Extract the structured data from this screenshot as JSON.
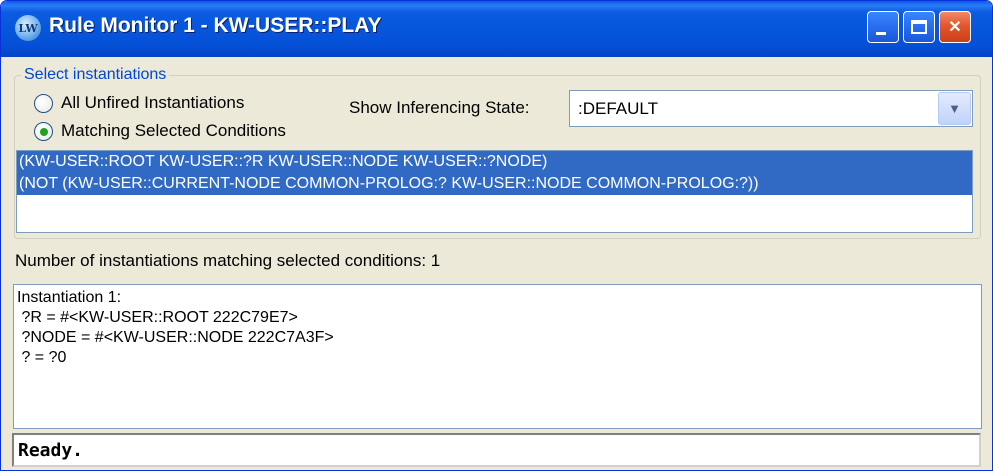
{
  "window": {
    "title": "Rule Monitor 1 - KW-USER::PLAY",
    "icon_label": "LW",
    "controls": [
      "minimize",
      "maximize",
      "close"
    ]
  },
  "select_instantiations": {
    "legend": "Select instantiations",
    "options": [
      {
        "label": "All Unfired Instantiations",
        "mnemonic": "A",
        "checked": false
      },
      {
        "label": "Matching Selected Conditions",
        "mnemonic": "M",
        "checked": true
      }
    ],
    "inferencing_state_label": "Show Inferencing State:",
    "inferencing_state_value": ":DEFAULT",
    "conditions": [
      "(KW-USER::ROOT KW-USER::?R KW-USER::NODE KW-USER::?NODE)",
      "(NOT (KW-USER::CURRENT-NODE COMMON-PROLOG:? KW-USER::NODE COMMON-PROLOG:?))"
    ]
  },
  "match_count_label": "Number of instantiations matching selected conditions: 1",
  "results": [
    "Instantiation 1:",
    " ?R = #<KW-USER::ROOT 222C79E7>",
    " ?NODE = #<KW-USER::NODE 222C7A3F>",
    " ? = ?0"
  ],
  "status": "Ready.",
  "colors": {
    "titlebar": "#0656dc",
    "selection": "#316ac5",
    "group_legend": "#0046d5",
    "close_button": "#e5562c"
  }
}
